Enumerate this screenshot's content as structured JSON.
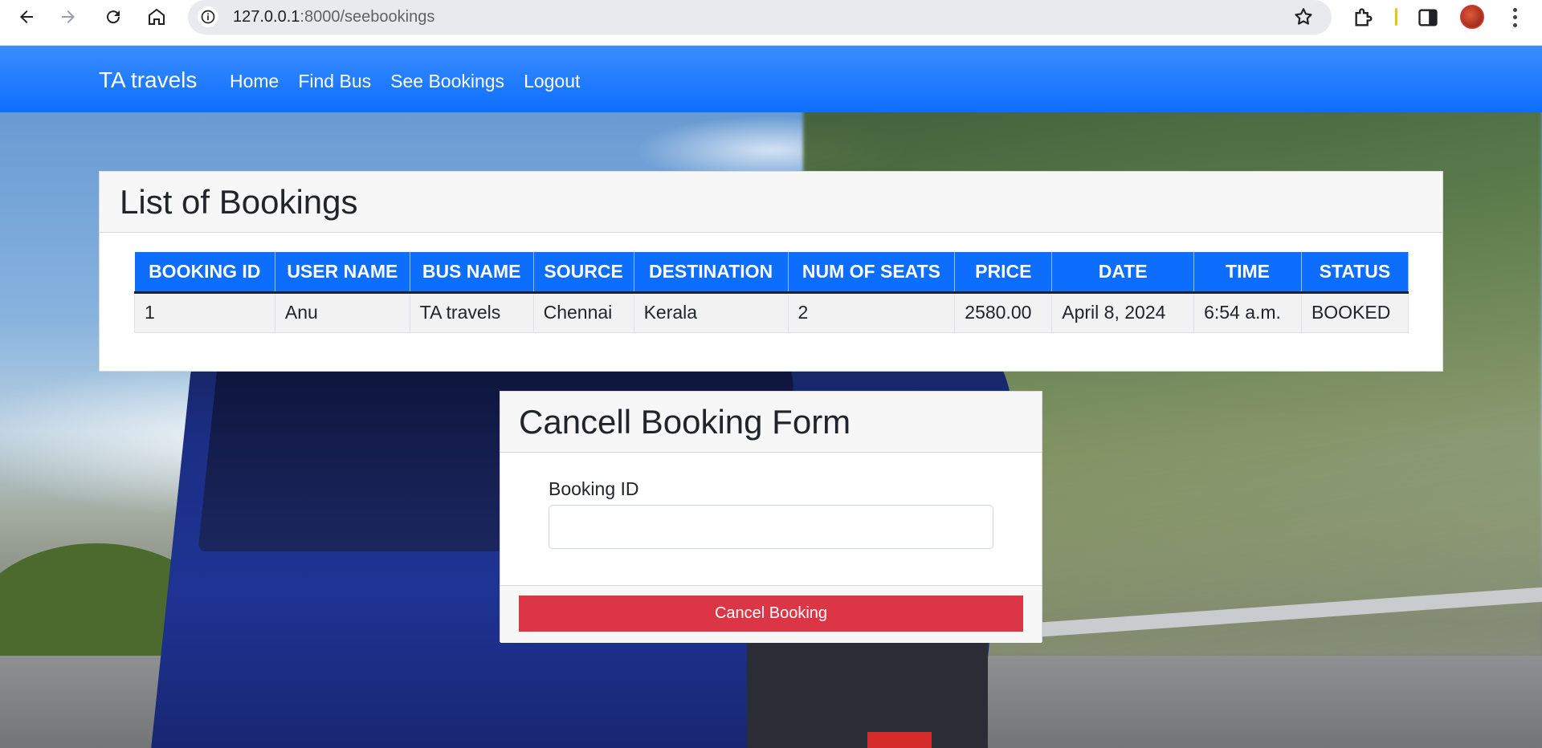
{
  "browser": {
    "url_host": "127.0.0.1",
    "url_rest": ":8000/seebookings"
  },
  "navbar": {
    "brand": "TA travels",
    "links": [
      "Home",
      "Find Bus",
      "See Bookings",
      "Logout"
    ]
  },
  "bookings": {
    "title": "List of Bookings",
    "columns": [
      "BOOKING ID",
      "USER NAME",
      "BUS NAME",
      "SOURCE",
      "DESTINATION",
      "NUM OF SEATS",
      "PRICE",
      "DATE",
      "TIME",
      "STATUS"
    ],
    "rows": [
      [
        "1",
        "Anu",
        "TA travels",
        "Chennai",
        "Kerala",
        "2",
        "2580.00",
        "April 8, 2024",
        "6:54 a.m.",
        "BOOKED"
      ]
    ]
  },
  "cancel_form": {
    "title": "Cancell Booking Form",
    "field_label": "Booking ID",
    "field_value": "",
    "button_label": "Cancel Booking"
  },
  "icons": {
    "back": "arrow-left-icon",
    "forward": "arrow-right-icon",
    "reload": "reload-icon",
    "home": "home-icon",
    "site_info": "info-icon",
    "bookmark": "star-icon",
    "extensions": "puzzle-icon",
    "side_panel": "side-panel-icon",
    "menu": "kebab-menu-icon"
  },
  "colors": {
    "navbar": "#0d6efd",
    "table_header": "#0d6efd",
    "cancel_button": "#dc3545"
  }
}
